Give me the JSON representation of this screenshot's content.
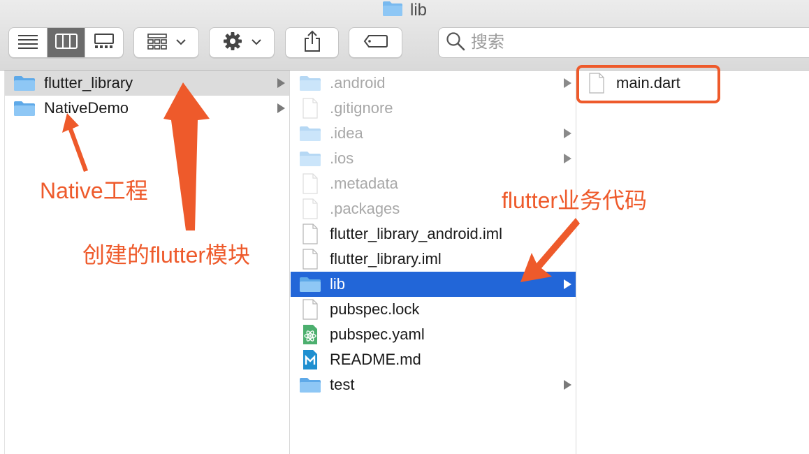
{
  "window": {
    "title": "lib"
  },
  "search": {
    "placeholder": "搜索"
  },
  "columns": [
    {
      "items": [
        {
          "name": "flutter_library",
          "kind": "folder",
          "has_children": true,
          "state": "inactive-selected",
          "dim": false
        },
        {
          "name": "NativeDemo",
          "kind": "folder",
          "has_children": true,
          "state": "",
          "dim": false
        }
      ]
    },
    {
      "items": [
        {
          "name": ".android",
          "kind": "folder",
          "has_children": true,
          "state": "",
          "dim": true
        },
        {
          "name": ".gitignore",
          "kind": "file",
          "has_children": false,
          "state": "",
          "dim": true
        },
        {
          "name": ".idea",
          "kind": "folder",
          "has_children": true,
          "state": "",
          "dim": true
        },
        {
          "name": ".ios",
          "kind": "folder",
          "has_children": true,
          "state": "",
          "dim": true
        },
        {
          "name": ".metadata",
          "kind": "file",
          "has_children": false,
          "state": "",
          "dim": true
        },
        {
          "name": ".packages",
          "kind": "file",
          "has_children": false,
          "state": "",
          "dim": true
        },
        {
          "name": "flutter_library_android.iml",
          "kind": "file",
          "has_children": false,
          "state": "",
          "dim": false
        },
        {
          "name": "flutter_library.iml",
          "kind": "file",
          "has_children": false,
          "state": "",
          "dim": false
        },
        {
          "name": "lib",
          "kind": "folder",
          "has_children": true,
          "state": "selected",
          "dim": false
        },
        {
          "name": "pubspec.lock",
          "kind": "file",
          "has_children": false,
          "state": "",
          "dim": false
        },
        {
          "name": "pubspec.yaml",
          "kind": "yaml",
          "has_children": false,
          "state": "",
          "dim": false
        },
        {
          "name": "README.md",
          "kind": "markdown",
          "has_children": false,
          "state": "",
          "dim": false
        },
        {
          "name": "test",
          "kind": "folder",
          "has_children": true,
          "state": "",
          "dim": false
        }
      ]
    },
    {
      "items": [
        {
          "name": "main.dart",
          "kind": "file",
          "has_children": false,
          "state": "",
          "dim": false
        }
      ]
    }
  ],
  "annotations": {
    "native": "Native工程",
    "module": "创建的flutter模块",
    "business": "flutter业务代码",
    "color": "#ee5a2b"
  },
  "colors": {
    "selection": "#2266d8",
    "inactive_selection": "#dcdcdc",
    "folder": "#78b9ef"
  },
  "icons": {
    "toolbar": [
      "list-view-icon",
      "column-view-icon",
      "gallery-view-icon",
      "group-icon",
      "gear-icon",
      "share-icon",
      "tag-icon"
    ],
    "search": "magnifier-icon"
  }
}
